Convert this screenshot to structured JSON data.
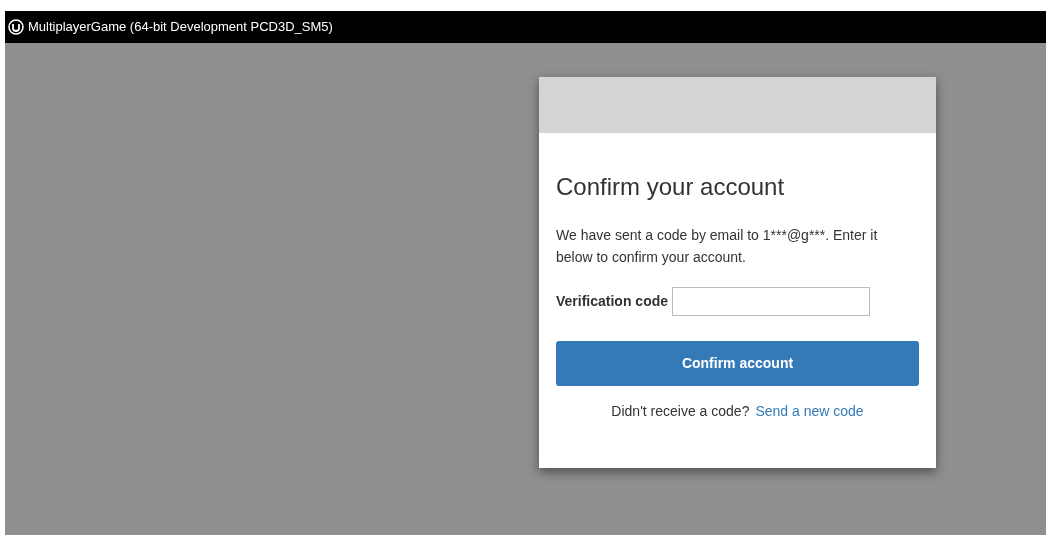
{
  "window": {
    "title": "MultiplayerGame (64-bit Development PCD3D_SM5)"
  },
  "dialog": {
    "heading": "Confirm your account",
    "message": "We have sent a code by email to 1***@g***. Enter it below to confirm your account.",
    "field": {
      "label": "Verification code"
    },
    "button": "Confirm account",
    "footer": {
      "text": "Didn't receive a code?",
      "link": "Send a new code"
    }
  }
}
